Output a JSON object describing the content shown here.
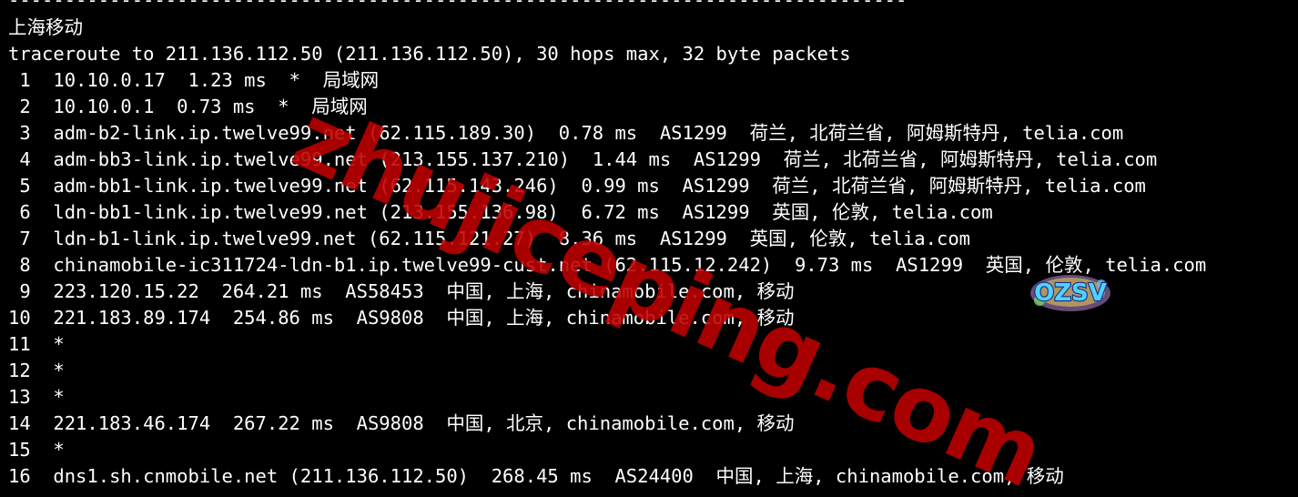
{
  "terminal": {
    "separator": "--------------------------------------------------------------------------------",
    "location": "上海移动",
    "header": "traceroute to 211.136.112.50 (211.136.112.50), 30 hops max, 32 byte packets",
    "hops": [
      " 1  10.10.0.17  1.23 ms  *  局域网",
      " 2  10.10.0.1  0.73 ms  *  局域网",
      " 3  adm-b2-link.ip.twelve99.net (62.115.189.30)  0.78 ms  AS1299  荷兰, 北荷兰省, 阿姆斯特丹, telia.com",
      " 4  adm-bb3-link.ip.twelve99.net (213.155.137.210)  1.44 ms  AS1299  荷兰, 北荷兰省, 阿姆斯特丹, telia.com",
      " 5  adm-bb1-link.ip.twelve99.net (62.115.143.246)  0.99 ms  AS1299  荷兰, 北荷兰省, 阿姆斯特丹, telia.com",
      " 6  ldn-bb1-link.ip.twelve99.net (213.155.136.98)  6.72 ms  AS1299  英国, 伦敦, telia.com",
      " 7  ldn-b1-link.ip.twelve99.net (62.115.121.27)  8.36 ms  AS1299  英国, 伦敦, telia.com",
      " 8  chinamobile-ic311724-ldn-b1.ip.twelve99-cust.net (62.115.12.242)  9.73 ms  AS1299  英国, 伦敦, telia.com",
      " 9  223.120.15.22  264.21 ms  AS58453  中国, 上海, chinamobile.com, 移动",
      "10  221.183.89.174  254.86 ms  AS9808  中国, 上海, chinamobile.com, 移动",
      "11  *",
      "12  *",
      "13  *",
      "14  221.183.46.174  267.22 ms  AS9808  中国, 北京, chinamobile.com, 移动",
      "15  *",
      "16  dns1.sh.cnmobile.net (211.136.112.50)  268.45 ms  AS24400  中国, 上海, chinamobile.com, 移动"
    ]
  },
  "watermark": {
    "text": "zhujiceping.com",
    "color": "#c00000"
  },
  "logo": {
    "text": "OZSV",
    "icon": "ozsv-logo-icon"
  },
  "colors": {
    "background": "#000000",
    "text": "#ffffff"
  }
}
